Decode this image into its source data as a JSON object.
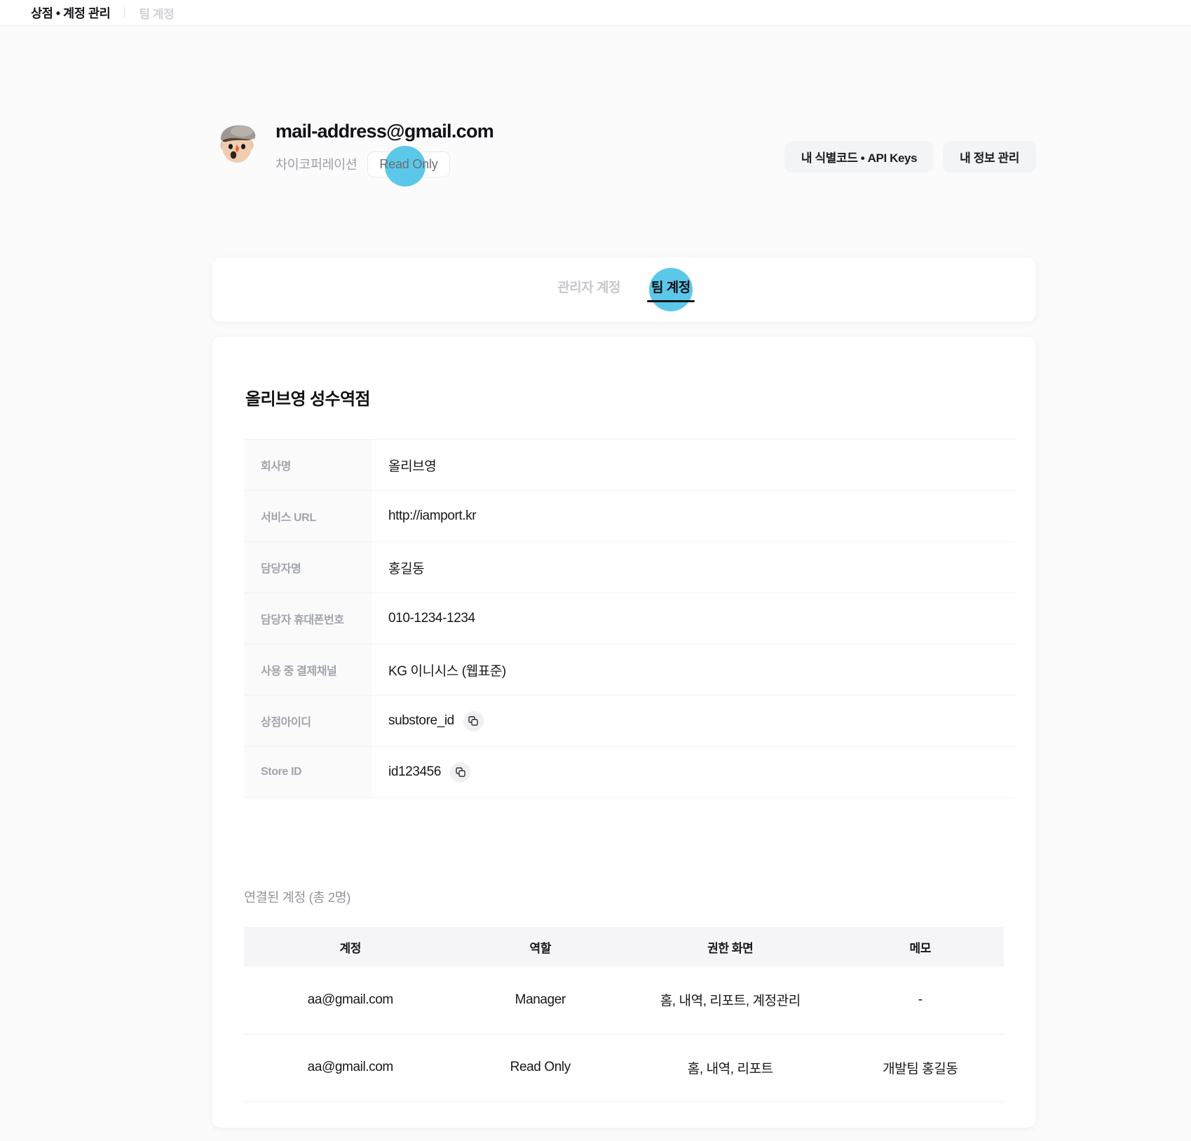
{
  "breadcrumb": {
    "current": "상점 • 계정 관리",
    "sub": "팀 계정"
  },
  "profile": {
    "email": "mail-address@gmail.com",
    "company": "차이코퍼레이션",
    "role_badge": "Read Only",
    "avatar_icon": "person-with-cap-avatar",
    "actions": [
      {
        "label": "내 식별코드 •  API Keys",
        "name": "api-keys-button"
      },
      {
        "label": "내 정보 관리",
        "name": "my-info-button"
      }
    ]
  },
  "tabs": [
    {
      "label": "관리자 계정",
      "active": false
    },
    {
      "label": "팀 계정",
      "active": true
    }
  ],
  "store": {
    "title": "올리브영 성수역점",
    "info_rows": [
      {
        "label": "회사명",
        "value": "올리브영",
        "copy": false
      },
      {
        "label": "서비스 URL",
        "value": "http://iamport.kr",
        "copy": false
      },
      {
        "label": "담당자명",
        "value": "홍길동",
        "copy": false
      },
      {
        "label": "담당자 휴대폰번호",
        "value": "010-1234-1234",
        "copy": false
      },
      {
        "label": "사용 중 결제채널",
        "value": "KG 이니시스 (웹표준)",
        "copy": false
      },
      {
        "label": "상점아이디",
        "value": "substore_id",
        "copy": true
      },
      {
        "label": "Store ID",
        "value": "id123456",
        "copy": true
      }
    ]
  },
  "linked_accounts": {
    "caption": "연결된 계정 (총 2명)",
    "columns": [
      "계정",
      "역할",
      "권한 화면",
      "메모"
    ],
    "rows": [
      {
        "account": "aa@gmail.com",
        "role": "Manager",
        "screens": "홈, 내역, 리포트, 계정관리",
        "memo": "-"
      },
      {
        "account": "aa@gmail.com",
        "role": "Read Only",
        "screens": "홈, 내역, 리포트",
        "memo": "개발팀 홍길동"
      }
    ]
  },
  "colors": {
    "highlight": "#5bc8ea",
    "page_background": "#fbfbfc",
    "card_background": "#ffffff",
    "muted_text": "#9ea1a8"
  },
  "icons": {
    "copy": "copy-icon"
  }
}
